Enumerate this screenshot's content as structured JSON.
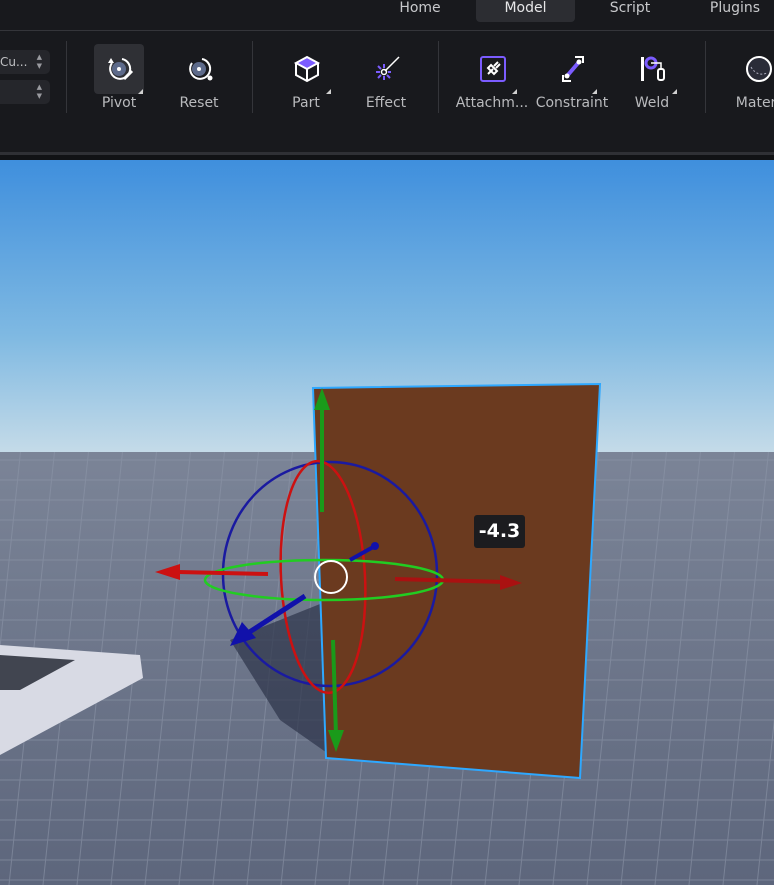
{
  "tabs": [
    {
      "label": "Home"
    },
    {
      "label": "Model",
      "active": true
    },
    {
      "label": "Script"
    },
    {
      "label": "Plugins"
    }
  ],
  "ribbon": {
    "fields": [
      {
        "value": "Cu..."
      },
      {
        "value": ""
      }
    ],
    "tools": [
      {
        "label": "Pivot",
        "icon": "pivot-edit-icon",
        "selected": true,
        "dropdown": true
      },
      {
        "label": "Reset",
        "icon": "pivot-reset-icon",
        "dropdown": false
      },
      {
        "label": "Part",
        "icon": "cube-icon",
        "dropdown": true
      },
      {
        "label": "Effect",
        "icon": "effect-wand-icon",
        "dropdown": false
      },
      {
        "label": "Attachm...",
        "icon": "attachment-plug-icon",
        "dropdown": true
      },
      {
        "label": "Constraint",
        "icon": "constraint-icon",
        "dropdown": true
      },
      {
        "label": "Weld",
        "icon": "weld-icon",
        "dropdown": true
      },
      {
        "label": "Materi",
        "icon": "material-sphere-icon",
        "dropdown": false
      }
    ]
  },
  "viewport": {
    "readout": "-4.3",
    "colors": {
      "part": "#6b3a1f",
      "selection": "#2ea8ff",
      "x_axis": "#cc1111",
      "y_axis": "#1a9a1a",
      "z_axis": "#1111aa",
      "accent": "#7b5cff"
    }
  }
}
